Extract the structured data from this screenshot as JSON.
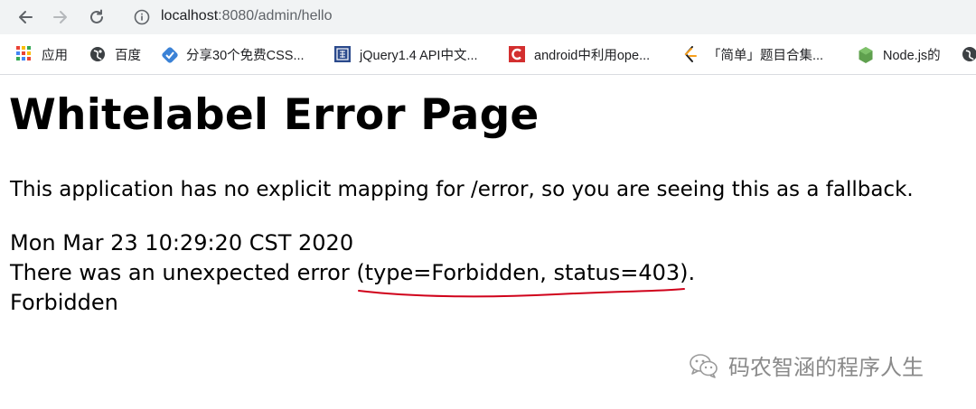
{
  "browser": {
    "url_host": "localhost",
    "url_path": ":8080/admin/hello",
    "icons": {
      "back": "back-arrow-icon",
      "forward": "forward-arrow-icon",
      "reload": "reload-icon",
      "info": "info-icon"
    }
  },
  "bookmarks": [
    {
      "label": "应用",
      "icon": "apps-grid-icon"
    },
    {
      "label": "百度",
      "icon": "globe-icon"
    },
    {
      "label": "分享30个免费CSS...",
      "icon": "blue-diamond-icon"
    },
    {
      "label": "jQuery1.4 API中文...",
      "icon": "jquery-seal-icon"
    },
    {
      "label": "android中利用ope...",
      "icon": "red-c-icon"
    },
    {
      "label": "「简单」题目合集...",
      "icon": "leetcode-icon"
    },
    {
      "label": "Node.js的",
      "icon": "node-hexagon-icon"
    },
    {
      "label": "",
      "icon": "globe-icon"
    }
  ],
  "page": {
    "title": "Whitelabel Error Page",
    "message": "This application has no explicit mapping for /error, so you are seeing this as a fallback.",
    "timestamp": "Mon Mar 23 10:29:20 CST 2020",
    "error_line": "There was an unexpected error (type=Forbidden, status=403).",
    "error_detail": "Forbidden"
  },
  "watermark": {
    "text": "码农智涵的程序人生",
    "icon": "wechat-icon"
  },
  "colors": {
    "toolbar_bg": "#f1f3f4",
    "annotation_red": "#d0021b",
    "watermark_gray": "#8a8a8a"
  }
}
